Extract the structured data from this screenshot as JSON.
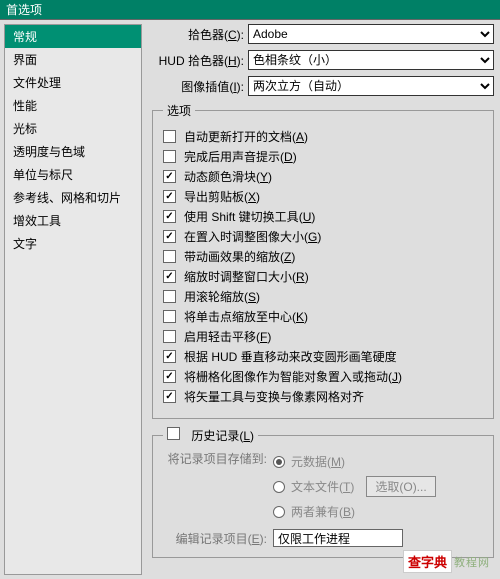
{
  "title": "首选项",
  "sidebar": {
    "items": [
      "常规",
      "界面",
      "文件处理",
      "性能",
      "光标",
      "透明度与色域",
      "单位与标尺",
      "参考线、网格和切片",
      "增效工具",
      "文字"
    ],
    "activeIndex": 0
  },
  "pickers": {
    "colorPicker": {
      "label": "拾色器",
      "mnemonic": "C",
      "value": "Adobe"
    },
    "hudPicker": {
      "label": "HUD 拾色器",
      "mnemonic": "H",
      "value": "色相条纹（小）"
    },
    "interpolation": {
      "label": "图像插值",
      "mnemonic": "I",
      "value": "两次立方（自动）"
    }
  },
  "optionsLegend": "选项",
  "options": [
    {
      "label": "自动更新打开的文档",
      "mnemonic": "A",
      "checked": false
    },
    {
      "label": "完成后用声音提示",
      "mnemonic": "D",
      "checked": false
    },
    {
      "label": "动态颜色滑块",
      "mnemonic": "Y",
      "checked": true
    },
    {
      "label": "导出剪贴板",
      "mnemonic": "X",
      "checked": true
    },
    {
      "label": "使用 Shift 键切换工具",
      "mnemonic": "U",
      "checked": true
    },
    {
      "label": "在置入时调整图像大小",
      "mnemonic": "G",
      "checked": true
    },
    {
      "label": "带动画效果的缩放",
      "mnemonic": "Z",
      "checked": false
    },
    {
      "label": "缩放时调整窗口大小",
      "mnemonic": "R",
      "checked": true
    },
    {
      "label": "用滚轮缩放",
      "mnemonic": "S",
      "checked": false
    },
    {
      "label": "将单击点缩放至中心",
      "mnemonic": "K",
      "checked": false
    },
    {
      "label": "启用轻击平移",
      "mnemonic": "F",
      "checked": false
    },
    {
      "label": "根据 HUD 垂直移动来改变圆形画笔硬度",
      "mnemonic": "",
      "checked": true
    },
    {
      "label": "将栅格化图像作为智能对象置入或拖动",
      "mnemonic": "J",
      "checked": true
    },
    {
      "label": "将矢量工具与变换与像素网格对齐",
      "mnemonic": "",
      "checked": true
    }
  ],
  "history": {
    "checkbox": {
      "label": "历史记录",
      "mnemonic": "L",
      "checked": false
    },
    "saveTo": {
      "label": "将记录项目存储到:"
    },
    "radios": [
      {
        "label": "元数据",
        "mnemonic": "M",
        "checked": true
      },
      {
        "label": "文本文件",
        "mnemonic": "T",
        "checked": false
      },
      {
        "label": "两者兼有",
        "mnemonic": "B",
        "checked": false
      }
    ],
    "chooseBtn": "选取(O)...",
    "editLabel": {
      "label": "编辑记录项目",
      "mnemonic": "E"
    },
    "editValue": "仅限工作进程"
  },
  "watermark": {
    "logo": "查字典",
    "text": "教程网",
    "url": "jiaocheng.chazidian.com"
  }
}
